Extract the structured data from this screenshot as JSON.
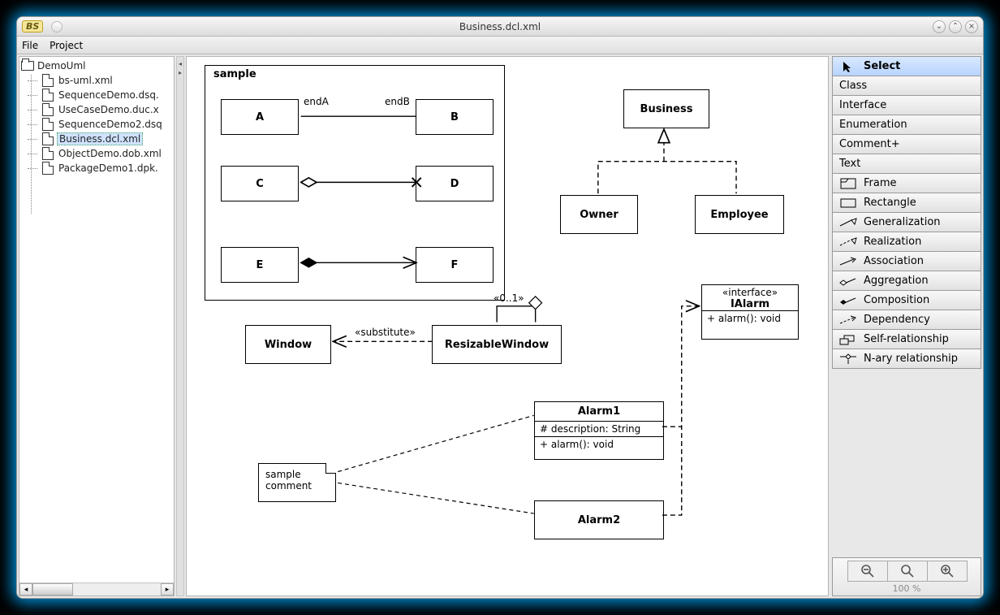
{
  "titlebar": {
    "badge": "BS",
    "title": "Business.dcl.xml",
    "min": "⌄",
    "max": "⌃",
    "close": "×"
  },
  "menubar": {
    "file": "File",
    "project": "Project"
  },
  "tree": {
    "root": "DemoUml",
    "items": [
      "bs-uml.xml",
      "SequenceDemo.dsq.",
      "UseCaseDemo.duc.x",
      "SequenceDemo2.dsq",
      "Business.dcl.xml",
      "ObjectDemo.dob.xml",
      "PackageDemo1.dpk."
    ],
    "selected_index": 4
  },
  "canvas": {
    "frame_label": "sample",
    "endA": "endA",
    "endB": "endB",
    "A": "A",
    "B": "B",
    "C": "C",
    "D": "D",
    "E": "E",
    "F": "F",
    "Business": "Business",
    "Owner": "Owner",
    "Employee": "Employee",
    "multiplicity": "«0..1»",
    "Window": "Window",
    "substitute": "«substitute»",
    "ResizableWindow": "ResizableWindow",
    "interface_stereo": "«interface»",
    "IAlarm": "IAlarm",
    "ialarm_op": "+ alarm(): void",
    "Alarm1": "Alarm1",
    "alarm1_attr": "# description: String",
    "alarm1_op": "+ alarm(): void",
    "Alarm2": "Alarm2",
    "comment_l1": "sample",
    "comment_l2": "comment"
  },
  "palette": {
    "select": "Select",
    "class": "Class",
    "interface": "Interface",
    "enum": "Enumeration",
    "comment": "Comment+",
    "text": "Text",
    "frame": "Frame",
    "rectangle": "Rectangle",
    "generalization": "Generalization",
    "realization": "Realization",
    "association": "Association",
    "aggregation": "Aggregation",
    "composition": "Composition",
    "dependency": "Dependency",
    "self": "Self-relationship",
    "nary": "N-ary relationship"
  },
  "zoom": {
    "label": "100 %"
  }
}
